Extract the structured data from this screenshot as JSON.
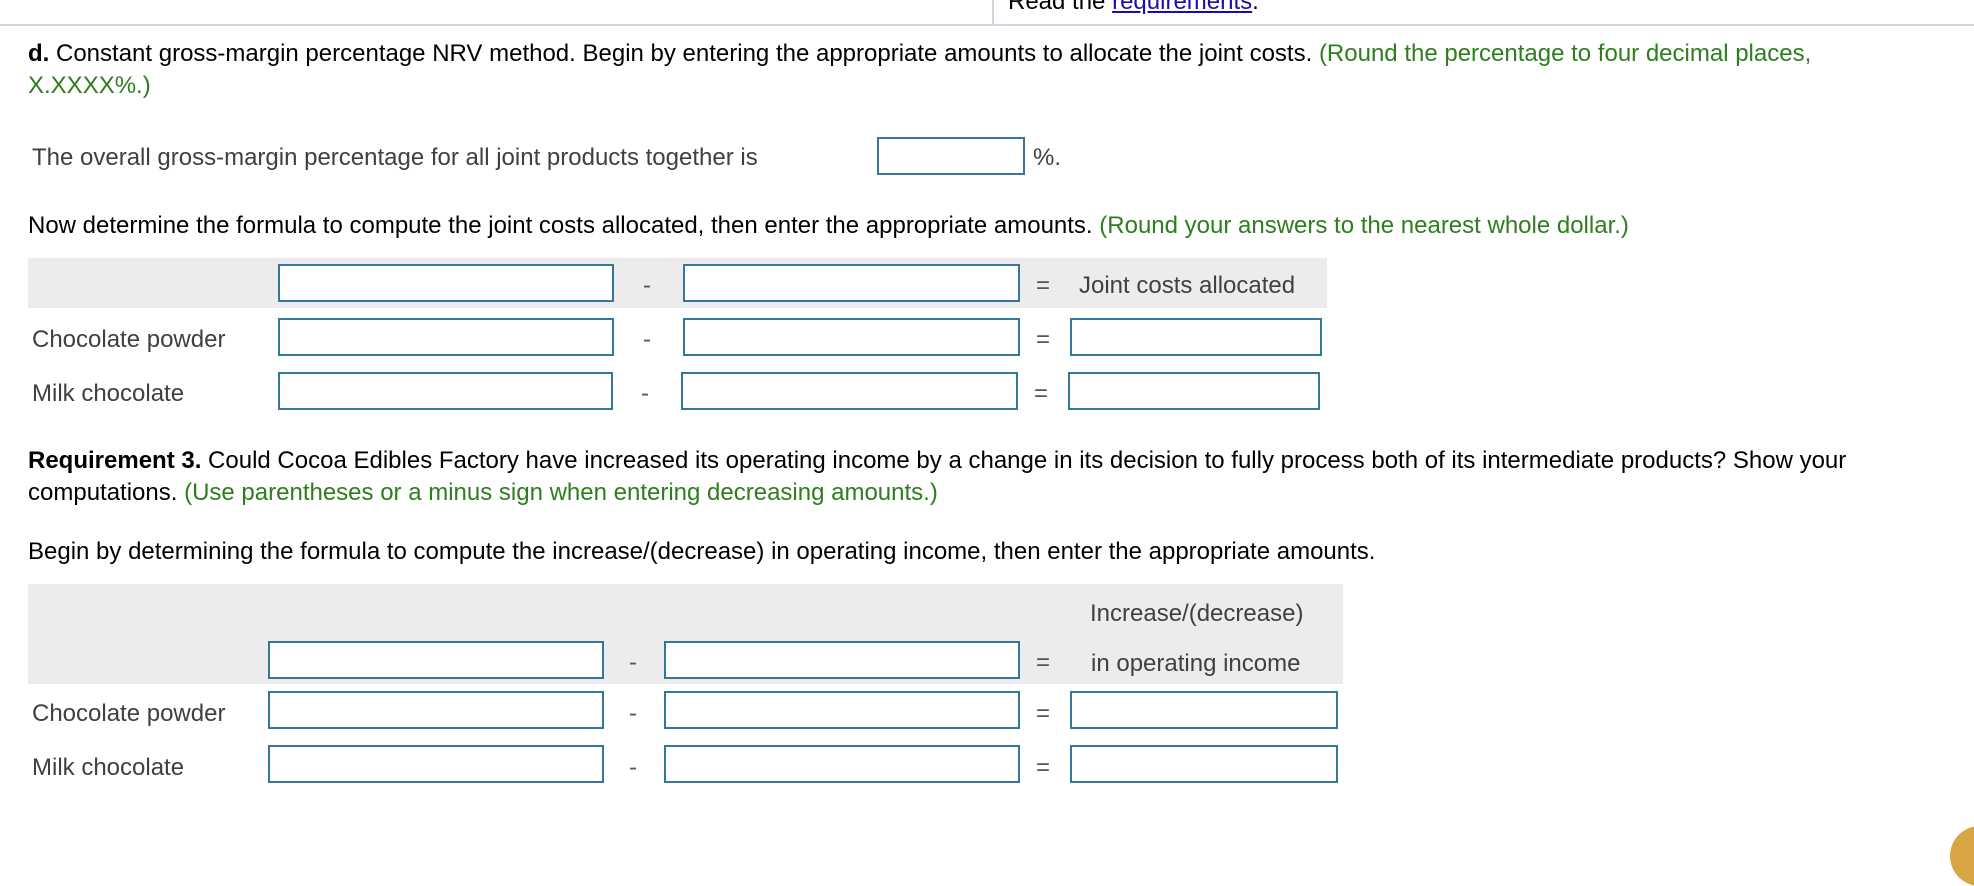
{
  "header": {
    "read_prefix": "Read the",
    "requirements_link": "requirements",
    "read_suffix": "."
  },
  "part_d": {
    "prefix_bold": "d.",
    "instruction": " Constant gross-margin percentage NRV method. Begin by entering the appropriate amounts to allocate the joint costs. ",
    "hint": "(Round  the percentage to four decimal places, X.XXXX%.)",
    "overall_label": "The overall gross-margin percentage for all joint products together is",
    "overall_value": "",
    "percent_suffix": "%.",
    "formula_instruction": "Now determine the formula to compute the joint costs allocated, then enter the appropriate amounts. ",
    "formula_hint": "(Round your answers to the nearest whole dollar.)",
    "table": {
      "result_header": "Joint costs allocated",
      "minus": "-",
      "equals": "=",
      "header_inputs": [
        "",
        ""
      ],
      "rows": [
        {
          "label": "Chocolate powder",
          "a": "",
          "b": "",
          "result": ""
        },
        {
          "label": "Milk chocolate",
          "a": "",
          "b": "",
          "result": ""
        }
      ]
    }
  },
  "requirement3": {
    "title_bold": "Requirement 3.",
    "question": " Could Cocoa Edibles Factory have increased its operating income by a change in its decision to fully process both of its intermediate products? Show your computations. ",
    "hint": "(Use parentheses or a minus sign when entering decreasing amounts.)",
    "formula_instruction": "Begin by determining the formula to compute the increase/(decrease) in operating income, then enter the appropriate amounts.",
    "table": {
      "result_header_line1": "Increase/(decrease)",
      "result_header_line2": "in operating income",
      "minus": "-",
      "equals": "=",
      "header_inputs": [
        "",
        ""
      ],
      "rows": [
        {
          "label": "Chocolate powder",
          "a": "",
          "b": "",
          "result": ""
        },
        {
          "label": "Milk chocolate",
          "a": "",
          "b": "",
          "result": ""
        }
      ]
    }
  },
  "colors": {
    "hint_green": "#2e7d1e",
    "input_border": "#33779a",
    "header_shade": "#ececec"
  }
}
